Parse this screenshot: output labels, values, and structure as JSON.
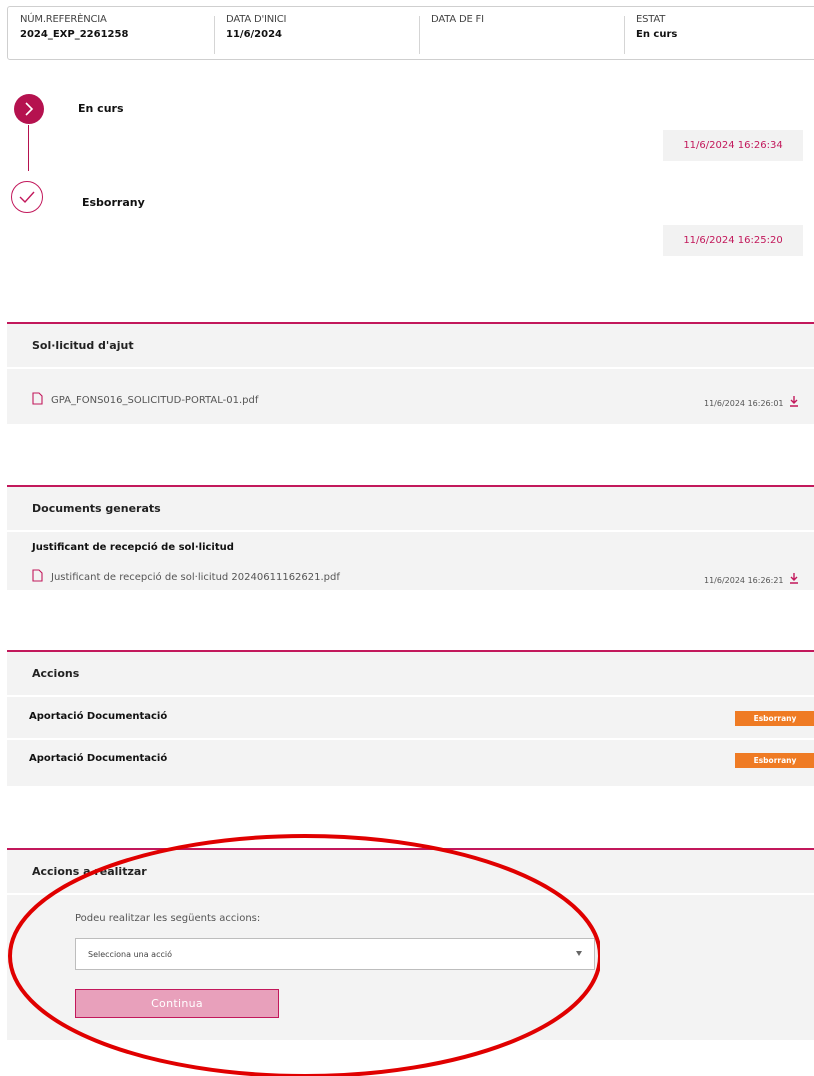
{
  "info": {
    "ref_label": "NÚM.REFERÈNCIA",
    "ref_value": "2024_EXP_2261258",
    "start_label": "DATA D'INICI",
    "start_value": "11/6/2024",
    "end_label": "DATA DE FI",
    "end_value": "",
    "status_label": "ESTAT",
    "status_value": "En curs"
  },
  "timeline": {
    "steps": [
      {
        "label": "En curs",
        "date": "11/6/2024 16:26:34",
        "icon": "chevron-right-icon"
      },
      {
        "label": "Esborrany",
        "date": "11/6/2024 16:25:20",
        "icon": "check-icon"
      }
    ]
  },
  "solicitud": {
    "title": "Sol·licitud d'ajut",
    "file_name": "GPA_FONS016_SOLICITUD-PORTAL-01.pdf",
    "file_date": "11/6/2024 16:26:01"
  },
  "documents": {
    "title": "Documents generats",
    "group_title": "Justificant de recepció de sol·licitud",
    "file_name": "Justificant de recepció de sol·licitud 20240611162621.pdf",
    "file_date": "11/6/2024 16:26:21"
  },
  "accions": {
    "title": "Accions",
    "items": [
      {
        "label": "Aportació Documentació",
        "status": "Esborrany"
      },
      {
        "label": "Aportació Documentació",
        "status": "Esborrany"
      }
    ]
  },
  "accions_realitzar": {
    "title": "Accions a realitzar",
    "intro": "Podeu realitzar les següents accions:",
    "select_value": "Selecciona una acció",
    "continue_label": "Continua"
  },
  "colors": {
    "accent": "#c2185b",
    "badge": "#ef7b24",
    "annotation": "#e00000"
  }
}
